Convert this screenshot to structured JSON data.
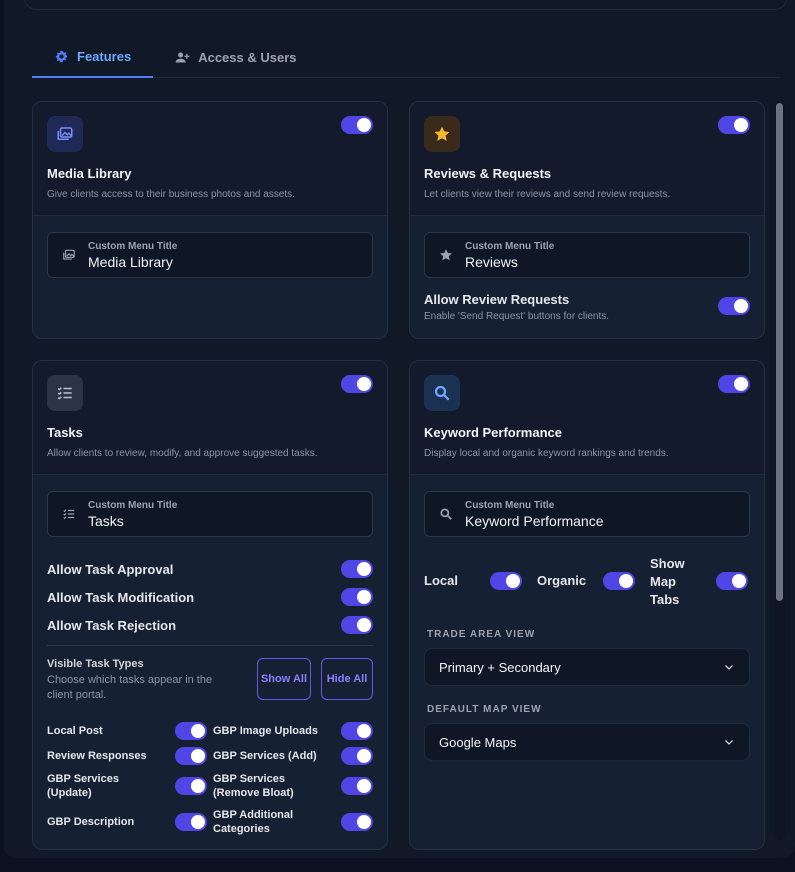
{
  "tabs": [
    {
      "label": "Features",
      "icon": "gear-icon",
      "active": true
    },
    {
      "label": "Access & Users",
      "icon": "user-plus-icon",
      "active": false
    }
  ],
  "media": {
    "title": "Media Library",
    "desc": "Give clients access to their business photos and assets.",
    "menu_label": "Custom Menu Title",
    "menu_value": "Media Library",
    "icon": "images-icon",
    "enabled": true
  },
  "reviews": {
    "title": "Reviews & Requests",
    "desc": "Let clients view their reviews and send review requests.",
    "menu_label": "Custom Menu Title",
    "menu_value": "Reviews",
    "icon": "star-icon",
    "enabled": true,
    "allow_label": "Allow Review Requests",
    "allow_desc": "Enable 'Send Request' buttons for clients.",
    "allow_enabled": true
  },
  "tasks": {
    "title": "Tasks",
    "desc": "Allow clients to review, modify, and approve suggested tasks.",
    "menu_label": "Custom Menu Title",
    "menu_value": "Tasks",
    "icon": "checklist-icon",
    "enabled": true,
    "options": [
      {
        "label": "Allow Task Approval",
        "enabled": true
      },
      {
        "label": "Allow Task Modification",
        "enabled": true
      },
      {
        "label": "Allow Task Rejection",
        "enabled": true
      }
    ],
    "visible_title": "Visible Task Types",
    "visible_desc": "Choose which tasks appear in the client portal.",
    "show_all": "Show All",
    "hide_all": "Hide All",
    "types": [
      {
        "label": "Local Post",
        "enabled": true
      },
      {
        "label": "GBP Image Uploads",
        "enabled": true
      },
      {
        "label": "Review Responses",
        "enabled": true
      },
      {
        "label": "GBP Services (Add)",
        "enabled": true
      },
      {
        "label": "GBP Services (Update)",
        "enabled": true
      },
      {
        "label": "GBP Services (Remove Bloat)",
        "enabled": true
      },
      {
        "label": "GBP Description",
        "enabled": true
      },
      {
        "label": "GBP Additional Categories",
        "enabled": true
      }
    ]
  },
  "keywords": {
    "title": "Keyword Performance",
    "desc": "Display local and organic keyword rankings and trends.",
    "menu_label": "Custom Menu Title",
    "menu_value": "Keyword Performance",
    "icon": "search-icon",
    "enabled": true,
    "local_label": "Local",
    "organic_label": "Organic",
    "map_tabs_label": "Show Map Tabs",
    "trade_label": "TRADE AREA VIEW",
    "trade_value": "Primary + Secondary",
    "map_label": "DEFAULT MAP VIEW",
    "map_value": "Google Maps"
  },
  "colors": {
    "accent": "#5046e5",
    "tab_active": "#6ea8fe",
    "star": "#f5b82e"
  }
}
